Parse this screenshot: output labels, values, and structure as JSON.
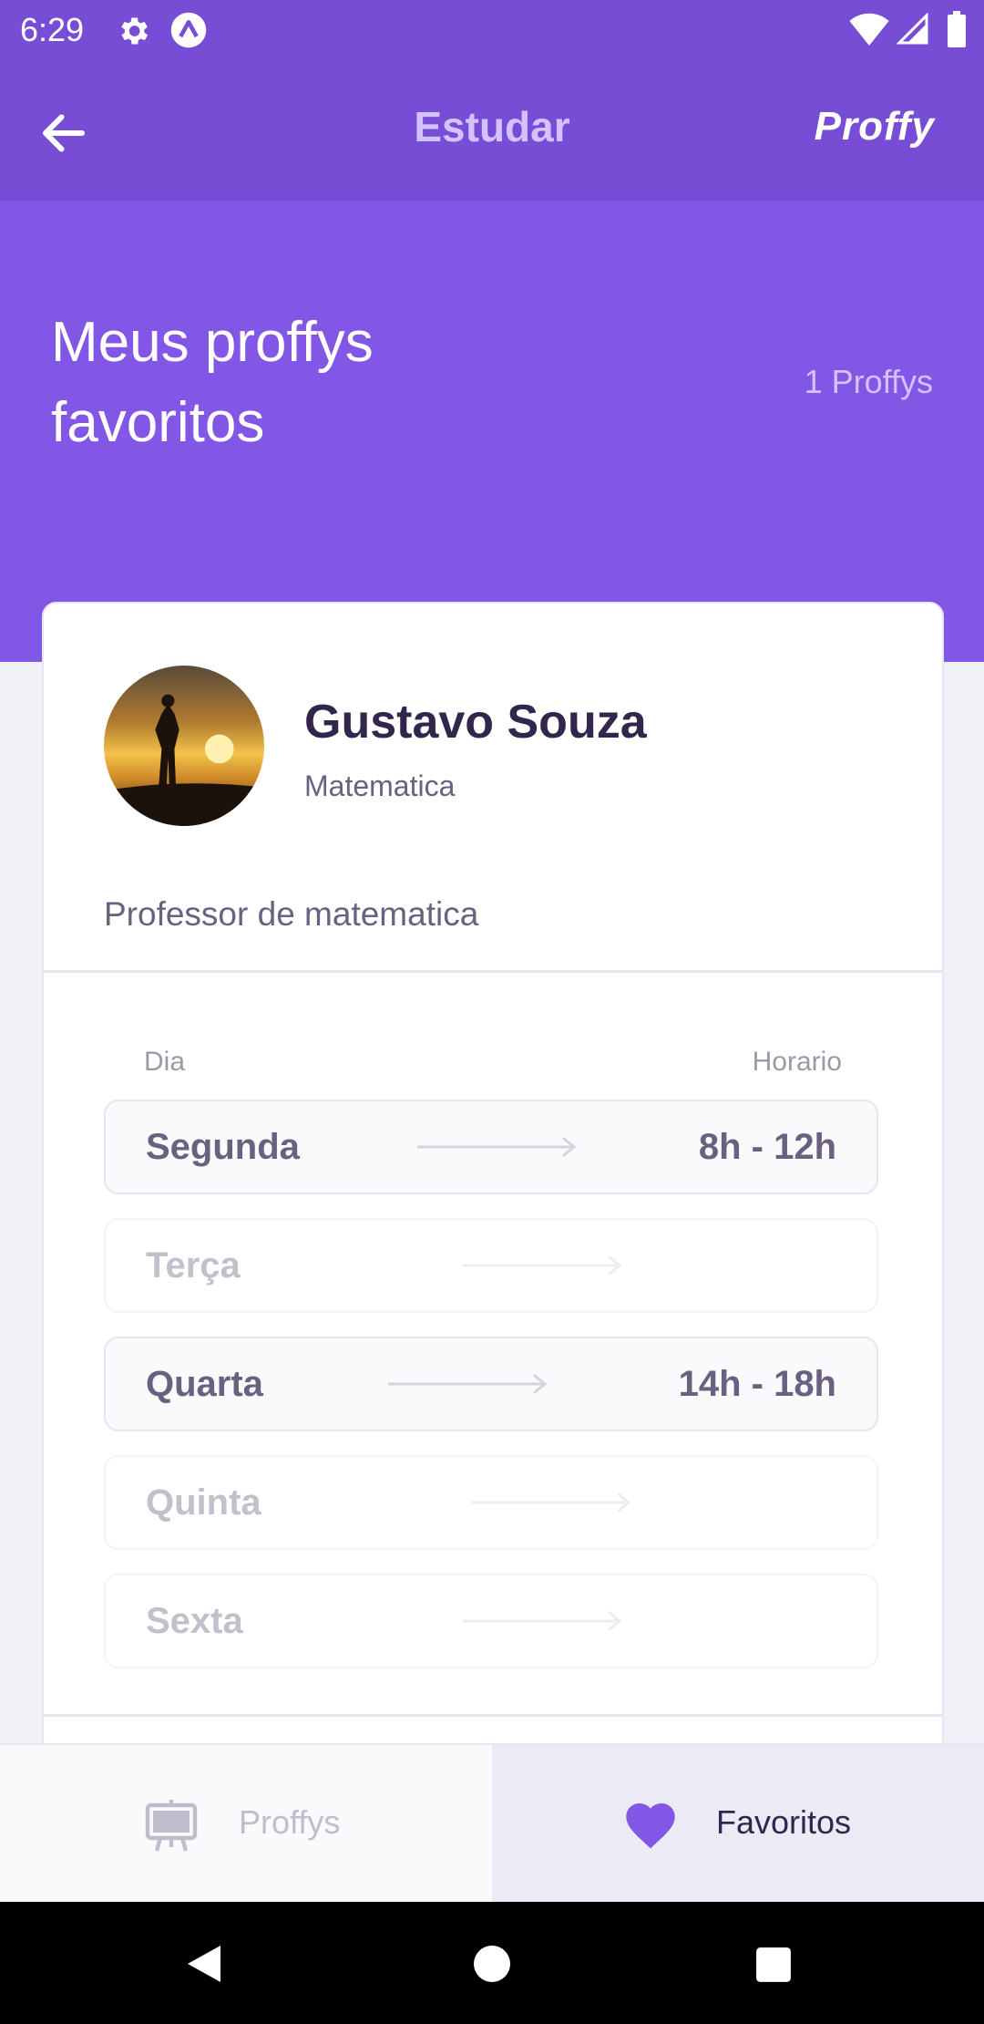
{
  "status_bar": {
    "time": "6:29"
  },
  "app_bar": {
    "title": "Estudar",
    "logo": "Proffy"
  },
  "hero": {
    "heading_line1": "Meus proffys",
    "heading_line2": "favoritos",
    "count": "1 Proffys"
  },
  "teacher": {
    "name": "Gustavo Souza",
    "subject": "Matematica",
    "bio": "Professor de matematica"
  },
  "schedule": {
    "header_day": "Dia",
    "header_time": "Horario",
    "rows": [
      {
        "day": "Segunda",
        "hours": "8h - 12h",
        "active": true
      },
      {
        "day": "Terça",
        "hours": "",
        "active": false
      },
      {
        "day": "Quarta",
        "hours": "14h - 18h",
        "active": true
      },
      {
        "day": "Quinta",
        "hours": "",
        "active": false
      },
      {
        "day": "Sexta",
        "hours": "",
        "active": false
      }
    ]
  },
  "tabs": [
    {
      "label": "Proffys",
      "icon": "easel-icon",
      "active": false
    },
    {
      "label": "Favoritos",
      "icon": "heart-icon",
      "active": true
    }
  ],
  "colors": {
    "primary": "#8257E5",
    "primary_dark": "#774DD6",
    "text_title": "#32264D",
    "text_base": "#6A6180"
  }
}
